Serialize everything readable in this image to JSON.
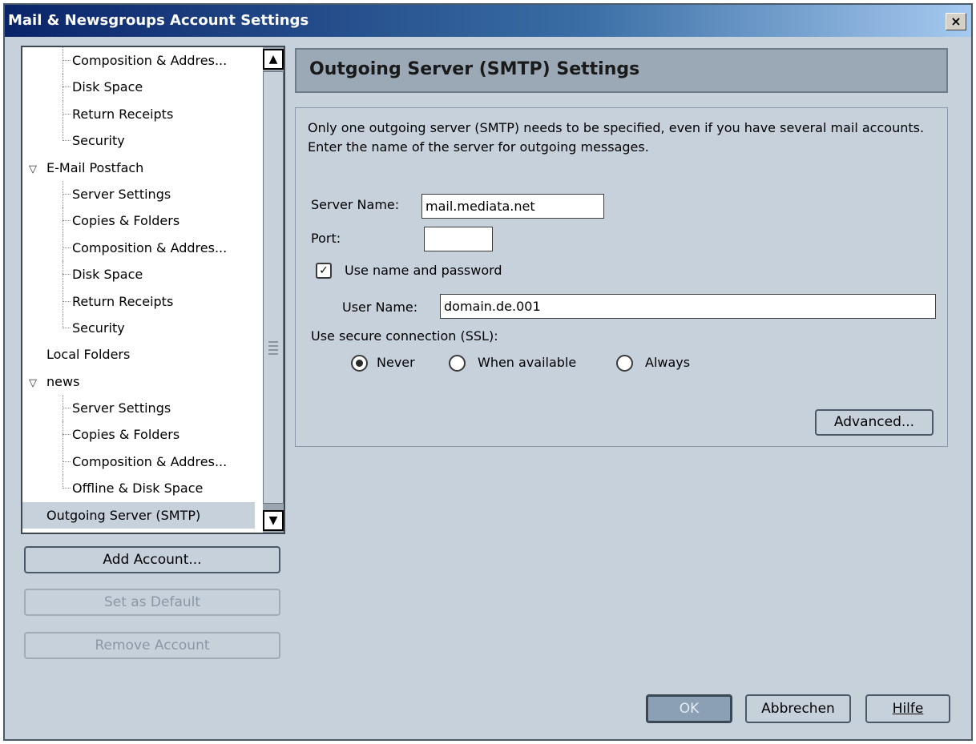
{
  "window": {
    "title": "Mail & Newsgroups Account Settings",
    "close_label": "×"
  },
  "tree": {
    "items": [
      {
        "label": "Composition & Addres...",
        "kind": "child"
      },
      {
        "label": "Disk Space",
        "kind": "child"
      },
      {
        "label": "Return Receipts",
        "kind": "child"
      },
      {
        "label": "Security",
        "kind": "child-last"
      },
      {
        "label": "E-Mail Postfach",
        "kind": "root",
        "expanded": true
      },
      {
        "label": "Server Settings",
        "kind": "child"
      },
      {
        "label": "Copies & Folders",
        "kind": "child"
      },
      {
        "label": "Composition & Addres...",
        "kind": "child"
      },
      {
        "label": "Disk Space",
        "kind": "child"
      },
      {
        "label": "Return Receipts",
        "kind": "child"
      },
      {
        "label": "Security",
        "kind": "child-last"
      },
      {
        "label": "Local Folders",
        "kind": "root-plain"
      },
      {
        "label": "news",
        "kind": "root",
        "expanded": true
      },
      {
        "label": "Server Settings",
        "kind": "child"
      },
      {
        "label": "Copies & Folders",
        "kind": "child"
      },
      {
        "label": "Composition & Addres...",
        "kind": "child"
      },
      {
        "label": "Offline & Disk Space",
        "kind": "child-last"
      },
      {
        "label": "Outgoing Server (SMTP)",
        "kind": "root-plain",
        "selected": true
      }
    ],
    "twisty_glyph": "▽",
    "scroll_up_glyph": "▲",
    "scroll_down_glyph": "▼"
  },
  "sidebar_buttons": {
    "add_account": "Add Account...",
    "set_default": "Set as Default",
    "remove_account": "Remove Account"
  },
  "panel": {
    "header": "Outgoing Server (SMTP) Settings",
    "description": "Only one outgoing server (SMTP) needs to be specified, even if you have several mail accounts. Enter the name of the server for outgoing messages.",
    "server_name_label": "Server Name:",
    "server_name_value": "mail.mediata.net",
    "port_label": "Port:",
    "port_value": "",
    "use_auth_label": "Use name and password",
    "use_auth_checked": true,
    "check_glyph": "✓",
    "user_name_label": "User Name:",
    "user_name_value": "domain.de.001",
    "ssl_label": "Use secure connection (SSL):",
    "ssl_options": [
      "Never",
      "When available",
      "Always"
    ],
    "ssl_selected": "Never",
    "advanced_button": "Advanced..."
  },
  "footer": {
    "ok": "OK",
    "cancel": "Abbrechen",
    "help": "Hilfe"
  }
}
